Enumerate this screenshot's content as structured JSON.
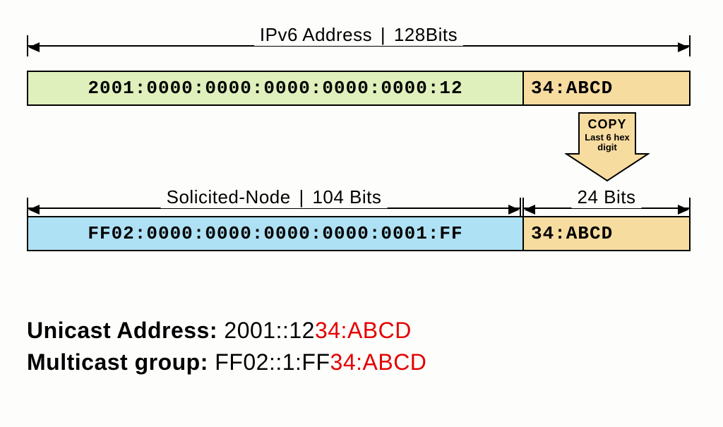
{
  "topDim": {
    "labelLeft": "IPv6 Address",
    "labelRight": "128Bits"
  },
  "ipv6Box": {
    "prefix": "2001:0000:0000:0000:0000:0000:12",
    "suffix": "34:ABCD"
  },
  "copyArrow": {
    "title": "COPY",
    "sub1": "Last 6 hex",
    "sub2": "digit"
  },
  "midDimLeft": {
    "labelLeft": "Solicited-Node",
    "labelRight": "104 Bits"
  },
  "midDimRight": {
    "label": "24 Bits"
  },
  "solicitedBox": {
    "prefix": "FF02:0000:0000:0000:0000:0001:FF",
    "suffix": "34:ABCD"
  },
  "summary": {
    "unicastLabel": "Unicast Address:",
    "unicastValBlack": "2001::12",
    "unicastValRed": "34:ABCD",
    "multicastLabel": "Multicast group:",
    "multicastValBlack": "FF02::1:FF",
    "multicastValRed": "34:ABCD"
  }
}
